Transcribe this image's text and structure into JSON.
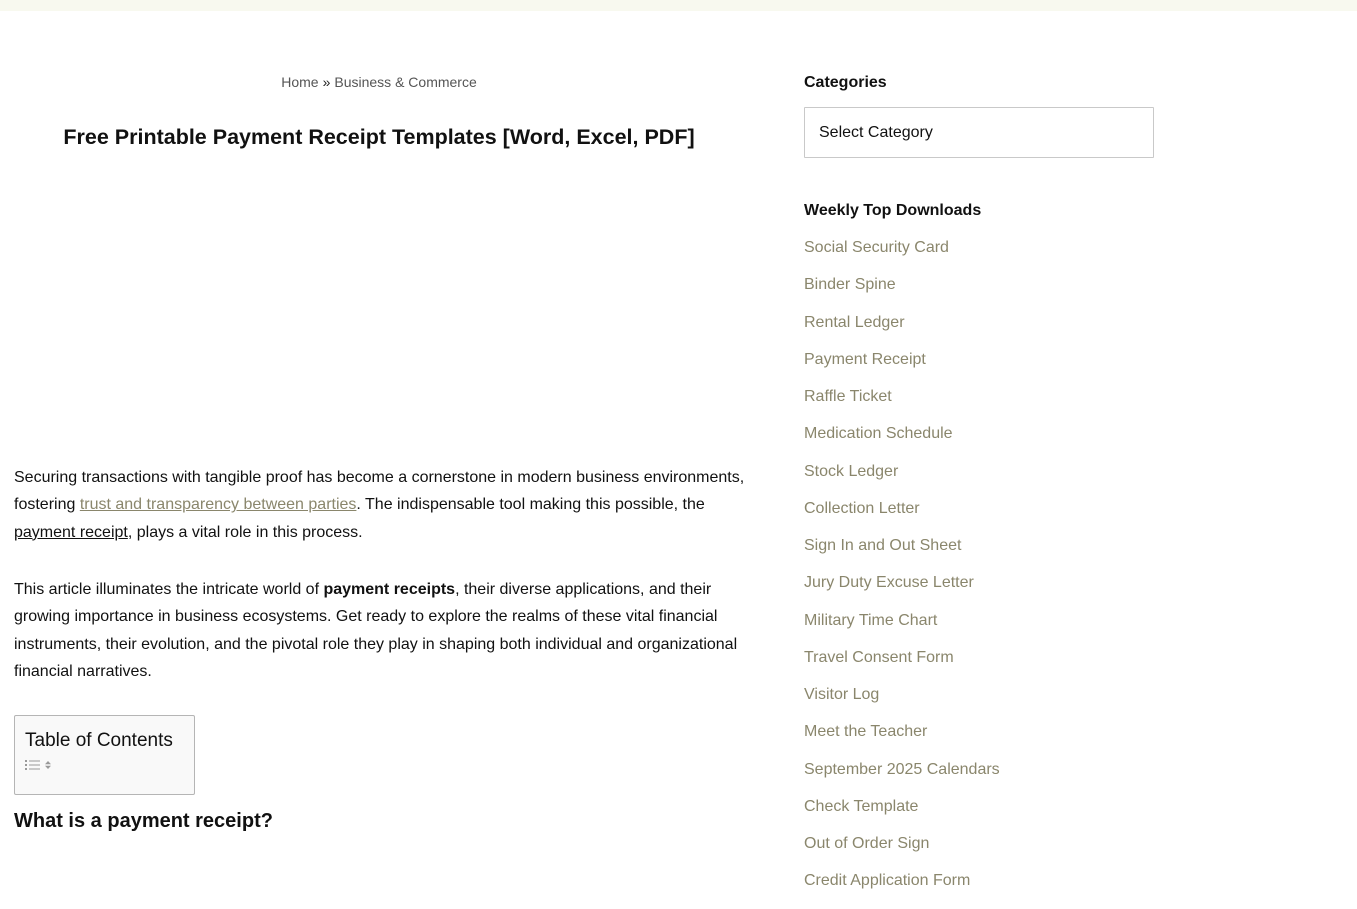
{
  "breadcrumb": {
    "home": "Home",
    "separator": "»",
    "category": "Business & Commerce"
  },
  "article": {
    "title": "Free Printable Payment Receipt Templates [Word, Excel, PDF]",
    "para1": {
      "text1": "Securing transactions with tangible proof has become a cornerstone in modern business environments, fostering ",
      "link1": "trust and transparency between parties",
      "text2": ". The indispensable tool making this possible, the ",
      "link2": "payment receipt",
      "text3": ", plays a vital role in this process."
    },
    "para2": {
      "text1": "This article illuminates the intricate world of ",
      "bold": "payment receipts",
      "text2": ", their diverse applications, and their growing importance in business ecosystems. Get ready to explore the realms of these vital financial instruments, their evolution, and the pivotal role they play in shaping both individual and organizational financial narratives."
    },
    "toc_title": "Table of Contents",
    "section_heading": "What is a payment receipt?"
  },
  "sidebar": {
    "categories_title": "Categories",
    "category_select_value": "Select Category",
    "downloads_title": "Weekly Top Downloads",
    "downloads": [
      "Social Security Card",
      "Binder Spine",
      "Rental Ledger",
      "Payment Receipt",
      "Raffle Ticket",
      "Medication Schedule",
      "Stock Ledger",
      "Collection Letter",
      "Sign In and Out Sheet",
      "Jury Duty Excuse Letter",
      "Military Time Chart",
      "Travel Consent Form",
      "Visitor Log",
      "Meet the Teacher",
      "September 2025 Calendars",
      "Check Template",
      "Out of Order Sign",
      "Credit Application Form"
    ]
  },
  "colors": {
    "link_muted": "#8a866c",
    "topbar": "#f8f9ef",
    "text": "#111111"
  },
  "icons": {
    "toc_toggle": "list-icon"
  }
}
